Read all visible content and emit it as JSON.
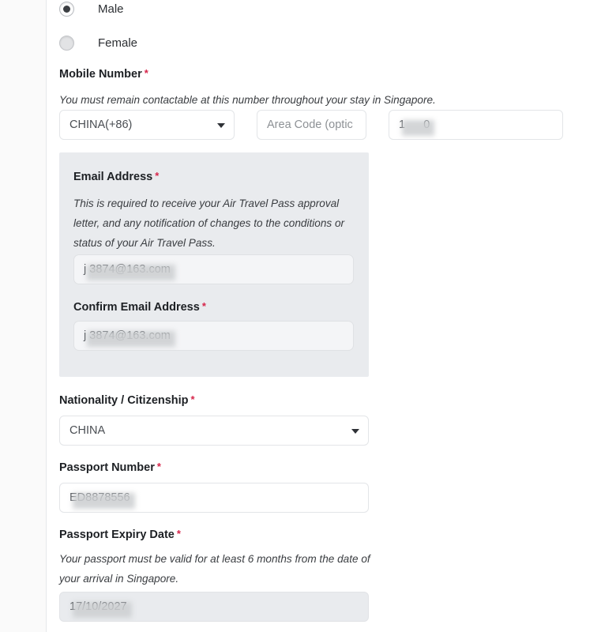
{
  "gender": {
    "options": [
      {
        "label": "Male",
        "selected": true
      },
      {
        "label": "Female",
        "selected": false
      }
    ]
  },
  "mobile": {
    "label": "Mobile Number",
    "required_mark": "*",
    "hint": "You must remain contactable at this number throughout your stay in Singapore.",
    "country_code_value": "CHINA(+86)",
    "area_code_placeholder": "Area Code (optic",
    "number_value": "1        0"
  },
  "email_panel": {
    "email_label": "Email Address",
    "email_required_mark": "*",
    "email_hint": "This is required to receive your Air Travel Pass approval letter, and any notification of changes to the conditions or status of your Air Travel Pass.",
    "email_value": "j    3874@163.com",
    "confirm_label": "Confirm Email Address",
    "confirm_required_mark": "*",
    "confirm_value": "j    3874@163.com"
  },
  "nationality": {
    "label": "Nationality / Citizenship",
    "required_mark": "*",
    "value": "CHINA"
  },
  "passport_number": {
    "label": "Passport Number",
    "required_mark": "*",
    "value": "ED8878556"
  },
  "passport_expiry": {
    "label": "Passport Expiry Date",
    "required_mark": "*",
    "hint": "Your passport must be valid for at least 6 months from the date of your arrival in Singapore.",
    "value": "17/10/2027"
  },
  "icons": {
    "dropdown": "chevron-down-icon"
  },
  "colors": {
    "required_asterisk": "#d6254a",
    "panel_background": "#e9ebee",
    "input_border": "#e3e5e8",
    "text_primary": "#1d2024"
  }
}
